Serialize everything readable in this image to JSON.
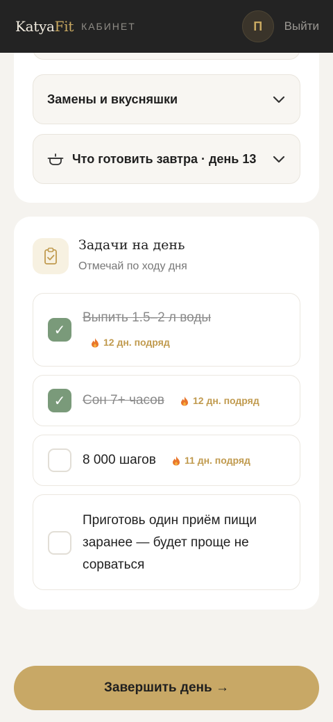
{
  "header": {
    "brand_main": "Katya",
    "brand_accent": "Fit",
    "section": "КАБИНЕТ",
    "avatar_letter": "П",
    "logout_label": "Выйти"
  },
  "meal_card": {
    "accordions": [
      {
        "label": "Замены и вкусняшки",
        "icon": "chevron-down-icon"
      },
      {
        "label": "Что готовить завтра · день 13",
        "icon": "pot-icon"
      }
    ]
  },
  "tasks_card": {
    "title": "Задачи на день",
    "subtitle": "Отмечай по ходу дня",
    "items": [
      {
        "text": "Выпить 1.5–2 л воды",
        "done": true,
        "streak": "12 дн. подряд"
      },
      {
        "text": "Сон 7+ часов",
        "done": true,
        "streak": "12 дн. подряд"
      },
      {
        "text": "8 000 шагов",
        "done": false,
        "streak": "11 дн. подряд"
      },
      {
        "text": "Приготовь один приём пищи заранее — будет проще не сорваться",
        "done": false
      }
    ]
  },
  "footer": {
    "finish_label": "Завершить день →"
  },
  "colors": {
    "accent_gold": "#c8a866",
    "check_green": "#7a9a7a",
    "topbar_dark": "#232323",
    "streak_gold": "#c09a4e"
  }
}
